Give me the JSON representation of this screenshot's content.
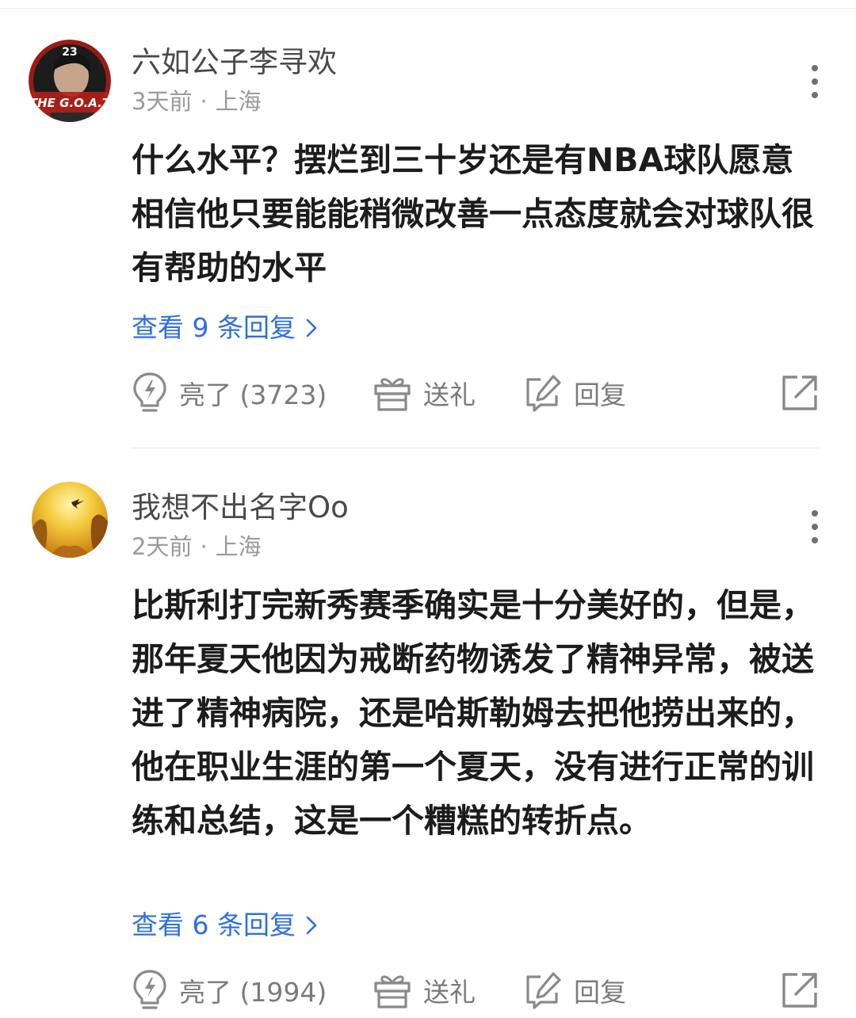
{
  "comments": [
    {
      "username": "六如公子李寻欢",
      "time": "3天前",
      "separator": "·",
      "location": "上海",
      "avatar_text": "THE G.O.A.T",
      "avatar_number": "23",
      "body": "什么水平？摆烂到三十岁还是有NBA球队愿意相信他只要能能稍微改善一点态度就会对球队很有帮助的水平",
      "view_replies": "查看 9 条回复",
      "like_label": "亮了 (3723)",
      "gift_label": "送礼",
      "reply_label": "回复"
    },
    {
      "username": "我想不出名字Oo",
      "time": "2天前",
      "separator": "·",
      "location": "上海",
      "body": "比斯利打完新秀赛季确实是十分美好的，但是，那年夏天他因为戒断药物诱发了精神异常，被送进了精神病院，还是哈斯勒姆去把他捞出来的，他在职业生涯的第一个夏天，没有进行正常的训练和总结，这是一个糟糕的转折点。",
      "view_replies": "查看 6 条回复",
      "like_label": "亮了 (1994)",
      "gift_label": "送礼",
      "reply_label": "回复"
    }
  ],
  "icons": {
    "like": "lightbulb-icon",
    "gift": "gift-icon",
    "reply": "edit-icon",
    "share": "share-icon",
    "more": "more-vertical-icon"
  },
  "colors": {
    "link_blue": "#2f6fe0",
    "icon_gray": "#8a8a8a",
    "meta_gray": "#9a9a9a"
  }
}
